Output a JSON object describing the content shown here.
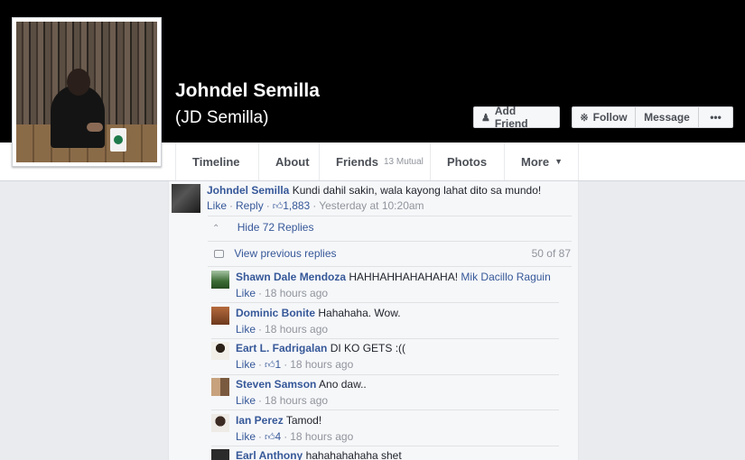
{
  "profile": {
    "name": "Johndel Semilla",
    "alternate_name": "(JD Semilla)"
  },
  "actions": {
    "add_friend": "Add Friend",
    "follow": "Follow",
    "message": "Message",
    "more": "•••"
  },
  "nav": {
    "timeline": "Timeline",
    "about": "About",
    "friends": "Friends",
    "friends_mutual": "13 Mutual",
    "photos": "Photos",
    "more": "More"
  },
  "main_comment": {
    "author": "Johndel Semilla",
    "text": "Kundi dahil sakin, wala kayong lahat dito sa mundo!",
    "like": "Like",
    "reply": "Reply",
    "likes": "1,883",
    "time": "Yesterday at 10:20am"
  },
  "replies_toggle": "Hide 72 Replies",
  "view_previous": "View previous replies",
  "reply_count": "50 of 87",
  "replies": [
    {
      "author": "Shawn Dale Mendoza",
      "text": "HAHHAHHAHAHAHA!",
      "mention": "Mik Dacillo Raguin",
      "like": "Like",
      "likes": "",
      "time": "18 hours ago"
    },
    {
      "author": "Dominic Bonite",
      "text": "Hahahaha. Wow.",
      "mention": "",
      "like": "Like",
      "likes": "",
      "time": "18 hours ago"
    },
    {
      "author": "Eart L. Fadrigalan",
      "text": "DI KO GETS :((",
      "mention": "",
      "like": "Like",
      "likes": "1",
      "time": "18 hours ago"
    },
    {
      "author": "Steven Samson",
      "text": "Ano daw..",
      "mention": "",
      "like": "Like",
      "likes": "",
      "time": "18 hours ago"
    },
    {
      "author": "Ian Perez",
      "text": "Tamod!",
      "mention": "",
      "like": "Like",
      "likes": "4",
      "time": "18 hours ago"
    },
    {
      "author": "Earl Anthony",
      "text": "hahahahahaha shet",
      "mention": "",
      "like": "",
      "likes": "",
      "time": ""
    }
  ]
}
